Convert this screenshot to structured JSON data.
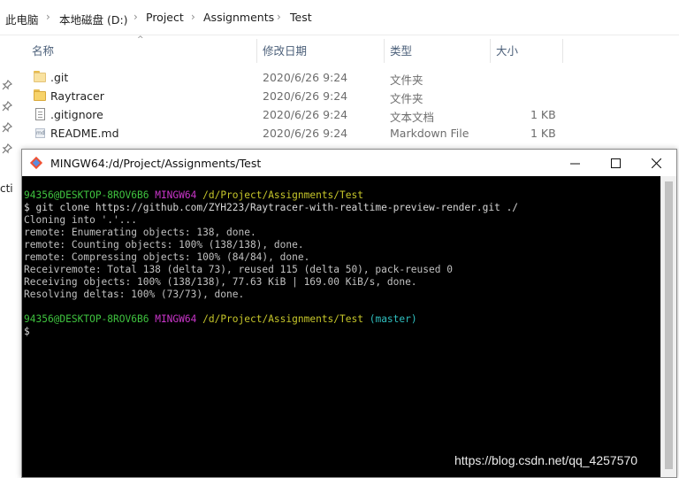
{
  "breadcrumb": [
    "此电脑",
    "本地磁盘 (D:)",
    "Project",
    "Assignments",
    "Test"
  ],
  "nav": {
    "cut_text": "cti"
  },
  "columns": [
    "名称",
    "修改日期",
    "类型",
    "大小"
  ],
  "files": [
    {
      "name": ".git",
      "date": "2020/6/26 9:24",
      "type": "文件夹",
      "size": "",
      "icon": "folder-icon"
    },
    {
      "name": "Raytracer",
      "date": "2020/6/26 9:24",
      "type": "文件夹",
      "size": "",
      "icon": "folder-icon"
    },
    {
      "name": ".gitignore",
      "date": "2020/6/26 9:24",
      "type": "文本文档",
      "size": "1 KB",
      "icon": "text-file-icon"
    },
    {
      "name": "README.md",
      "date": "2020/6/26 9:24",
      "type": "Markdown File",
      "size": "1 KB",
      "icon": "markdown-file-icon"
    }
  ],
  "terminal": {
    "title": "MINGW64:/d/Project/Assignments/Test",
    "prompt1": {
      "user": "94356@DESKTOP-8ROV6B6",
      "env": "MINGW64",
      "path": "/d/Project/Assignments/Test"
    },
    "command": "$ git clone https://github.com/ZYH223/Raytracer-with-realtime-preview-render.git ./",
    "output": [
      "Cloning into '.'...",
      "remote: Enumerating objects: 138, done.",
      "remote: Counting objects: 100% (138/138), done.",
      "remote: Compressing objects: 100% (84/84), done.",
      "Receivremote: Total 138 (delta 73), reused 115 (delta 50), pack-reused 0",
      "Receiving objects: 100% (138/138), 77.63 KiB | 169.00 KiB/s, done.",
      "Resolving deltas: 100% (73/73), done."
    ],
    "prompt2": {
      "user": "94356@DESKTOP-8ROV6B6",
      "env": "MINGW64",
      "path": "/d/Project/Assignments/Test",
      "branch": "(master)"
    },
    "cursor_line": "$"
  },
  "watermark": "https://blog.csdn.net/qq_4257570",
  "colors": {
    "prompt_user": "#3fc33f",
    "prompt_env": "#c935c9",
    "prompt_path": "#c6c62a",
    "branch": "#2fbfbf",
    "console_bg": "#000000"
  }
}
